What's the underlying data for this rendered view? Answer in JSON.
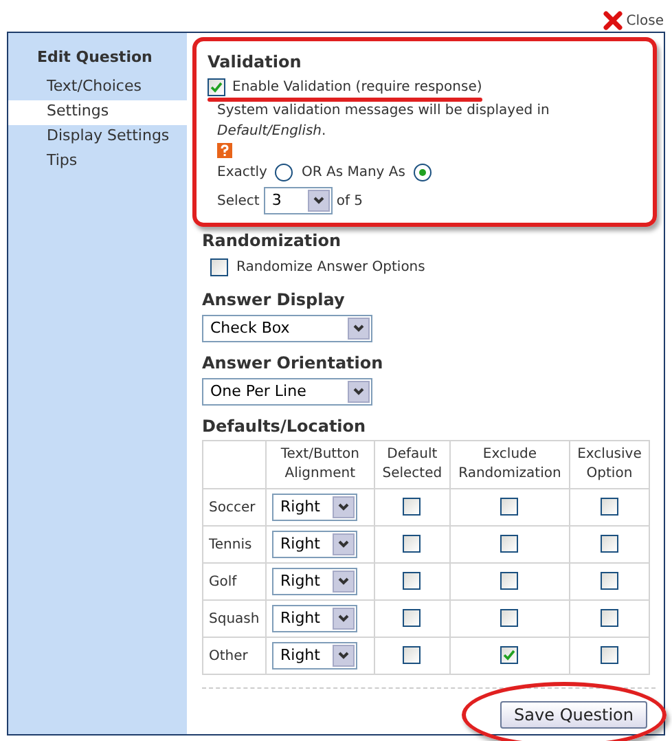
{
  "close": {
    "label": "Close"
  },
  "sidebar": {
    "title": "Edit Question",
    "items": [
      {
        "label": "Text/Choices",
        "selected": false
      },
      {
        "label": "Settings",
        "selected": true
      },
      {
        "label": "Display Settings",
        "selected": false
      },
      {
        "label": "Tips",
        "selected": false
      }
    ]
  },
  "validation": {
    "title": "Validation",
    "enable": {
      "label": "Enable Validation (require response)",
      "checked": true
    },
    "message": "System validation messages will be displayed in *Default/English*.",
    "modes": [
      {
        "label": "Exactly",
        "selected": false
      },
      {
        "label": "OR As Many As",
        "selected": true
      }
    ],
    "select_label": "Select",
    "select_value": "3",
    "of_label": "of 5"
  },
  "randomization": {
    "title": "Randomization",
    "option": {
      "label": "Randomize Answer Options",
      "checked": false
    }
  },
  "answer_display": {
    "title": "Answer Display",
    "value": "Check Box"
  },
  "answer_orientation": {
    "title": "Answer Orientation",
    "value": "One Per Line"
  },
  "defaults": {
    "title": "Defaults/Location",
    "columns": [
      "Text/Button Alignment",
      "Default Selected",
      "Exclude Randomization",
      "Exclusive Option"
    ],
    "rows": [
      {
        "label": "Soccer",
        "alignment": "Right",
        "default_selected": false,
        "exclude_randomization": false,
        "exclusive": false
      },
      {
        "label": "Tennis",
        "alignment": "Right",
        "default_selected": false,
        "exclude_randomization": false,
        "exclusive": false
      },
      {
        "label": "Golf",
        "alignment": "Right",
        "default_selected": false,
        "exclude_randomization": false,
        "exclusive": false
      },
      {
        "label": "Squash",
        "alignment": "Right",
        "default_selected": false,
        "exclude_randomization": false,
        "exclusive": false
      },
      {
        "label": "Other",
        "alignment": "Right",
        "default_selected": false,
        "exclude_randomization": true,
        "exclusive": false
      }
    ]
  },
  "save_button": {
    "label": "Save Question"
  }
}
